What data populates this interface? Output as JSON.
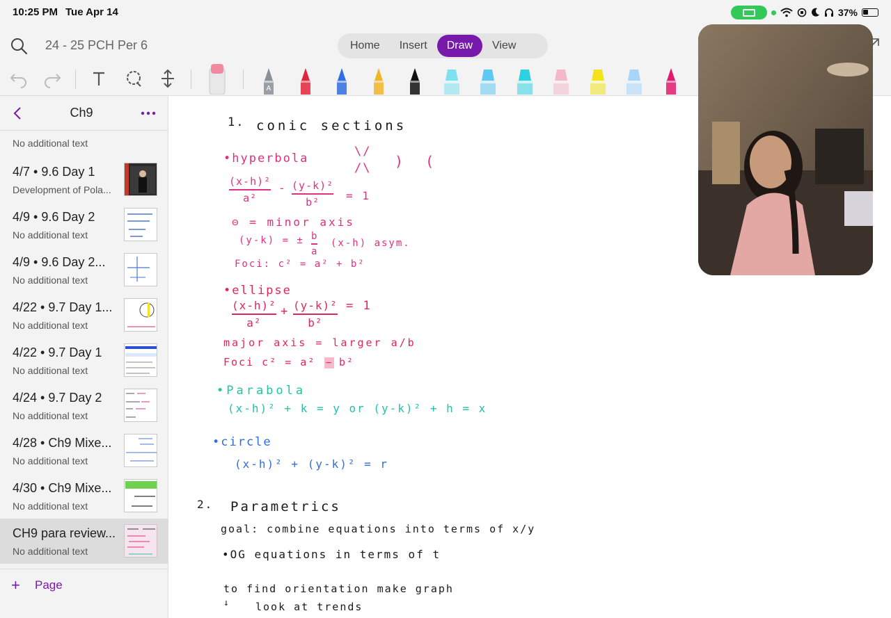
{
  "status": {
    "time": "10:25 PM",
    "date": "Tue Apr 14",
    "battery": "37%",
    "battery_level": 0.37
  },
  "toolbar": {
    "notebook_title": "24 - 25 PCH Per 6",
    "tabs": [
      {
        "label": "Home",
        "active": false
      },
      {
        "label": "Insert",
        "active": false
      },
      {
        "label": "Draw",
        "active": true
      },
      {
        "label": "View",
        "active": false
      }
    ],
    "tools": [
      "undo-icon",
      "redo-icon",
      "text-tool-icon",
      "lasso-select-icon",
      "add-space-icon",
      "eraser-icon"
    ],
    "pens": [
      {
        "kind": "marker",
        "color": "#8a8f98",
        "letter": "A"
      },
      {
        "kind": "marker",
        "color": "#e3243b"
      },
      {
        "kind": "marker",
        "color": "#2f6de0"
      },
      {
        "kind": "marker",
        "color": "#f0b429"
      },
      {
        "kind": "marker",
        "color": "#111111"
      },
      {
        "kind": "highlighter",
        "color": "#7fe0f0"
      },
      {
        "kind": "highlighter",
        "color": "#5ec8f0"
      },
      {
        "kind": "highlighter",
        "color": "#2fd0e0"
      },
      {
        "kind": "highlighter",
        "color": "#f3b9c8"
      },
      {
        "kind": "highlighter",
        "color": "#f3e21e"
      },
      {
        "kind": "highlighter",
        "color": "#a8d4f5"
      },
      {
        "kind": "marker",
        "color": "#e21a6e"
      }
    ]
  },
  "sidebar": {
    "section_title": "Ch9",
    "first_page_subtitle": "No additional text",
    "pages": [
      {
        "title": "4/7 • 9.6 Day 1",
        "subtitle": "Development of Pola...",
        "selected": false
      },
      {
        "title": "4/9 • 9.6 Day 2",
        "subtitle": "No additional text",
        "selected": false
      },
      {
        "title": "4/9 • 9.6 Day 2...",
        "subtitle": "No additional text",
        "selected": false
      },
      {
        "title": "4/22 • 9.7 Day 1...",
        "subtitle": "No additional text",
        "selected": false
      },
      {
        "title": "4/22 • 9.7 Day 1",
        "subtitle": "No additional text",
        "selected": false
      },
      {
        "title": "4/24 • 9.7 Day 2",
        "subtitle": "No additional text",
        "selected": false
      },
      {
        "title": "4/28 • Ch9 Mixe...",
        "subtitle": "No additional text",
        "selected": false
      },
      {
        "title": "4/30 • Ch9 Mixe...",
        "subtitle": "No additional text",
        "selected": false
      },
      {
        "title": "CH9 para review...",
        "subtitle": "No additional text",
        "selected": true
      }
    ],
    "add_page_label": "Page"
  },
  "notes": {
    "s1_num": "1.",
    "s1_title": "conic sections",
    "hyperbola": "•hyperbola",
    "hyp_shapes_v": "\\/",
    "hyp_shapes_rest": ") (",
    "hyp_shapes_bottom": "/\\",
    "hyp_eq_num1": "(x-h)²",
    "hyp_eq_den1": "a²",
    "hyp_eq_minus": "-",
    "hyp_eq_num2": "(y-k)²",
    "hyp_eq_den2": "b²",
    "hyp_eq_rhs": "= 1",
    "minor_axis": "⊖  =   minor axis",
    "asym_left": "(y-k) = ±",
    "asym_num": "b",
    "asym_den": "a",
    "asym_right": "(x-h)  asym.",
    "hyp_foci": "Foci:  c² = a² + b²",
    "ellipse": "•ellipse",
    "ell_num1": "(x-h)²",
    "ell_den1": "a²",
    "ell_plus": "+",
    "ell_num2": "(y-k)²",
    "ell_den2": "b²",
    "ell_rhs": "= 1",
    "major_axis": "major  axis = larger a/b",
    "ell_foci_left": "Foci   c² = a²",
    "ell_foci_minus": "−",
    "ell_foci_right": "b²",
    "parabola": "•Parabola",
    "parabola_eq": "(x-h)² + k = y    or    (y-k)² + h = x",
    "circle": "•circle",
    "circle_eq": "(x-h)²  +  (y-k)² = r",
    "s2_num": "2.",
    "s2_title": "Parametrics",
    "goal": "goal: combine  equations  into   terms of x/y",
    "og": "•OG  equations  in  terms  of  t",
    "orient1": "to   find   orientation  make  graph",
    "orient2_mark": "↓",
    "orient2": "look  at  trends"
  }
}
